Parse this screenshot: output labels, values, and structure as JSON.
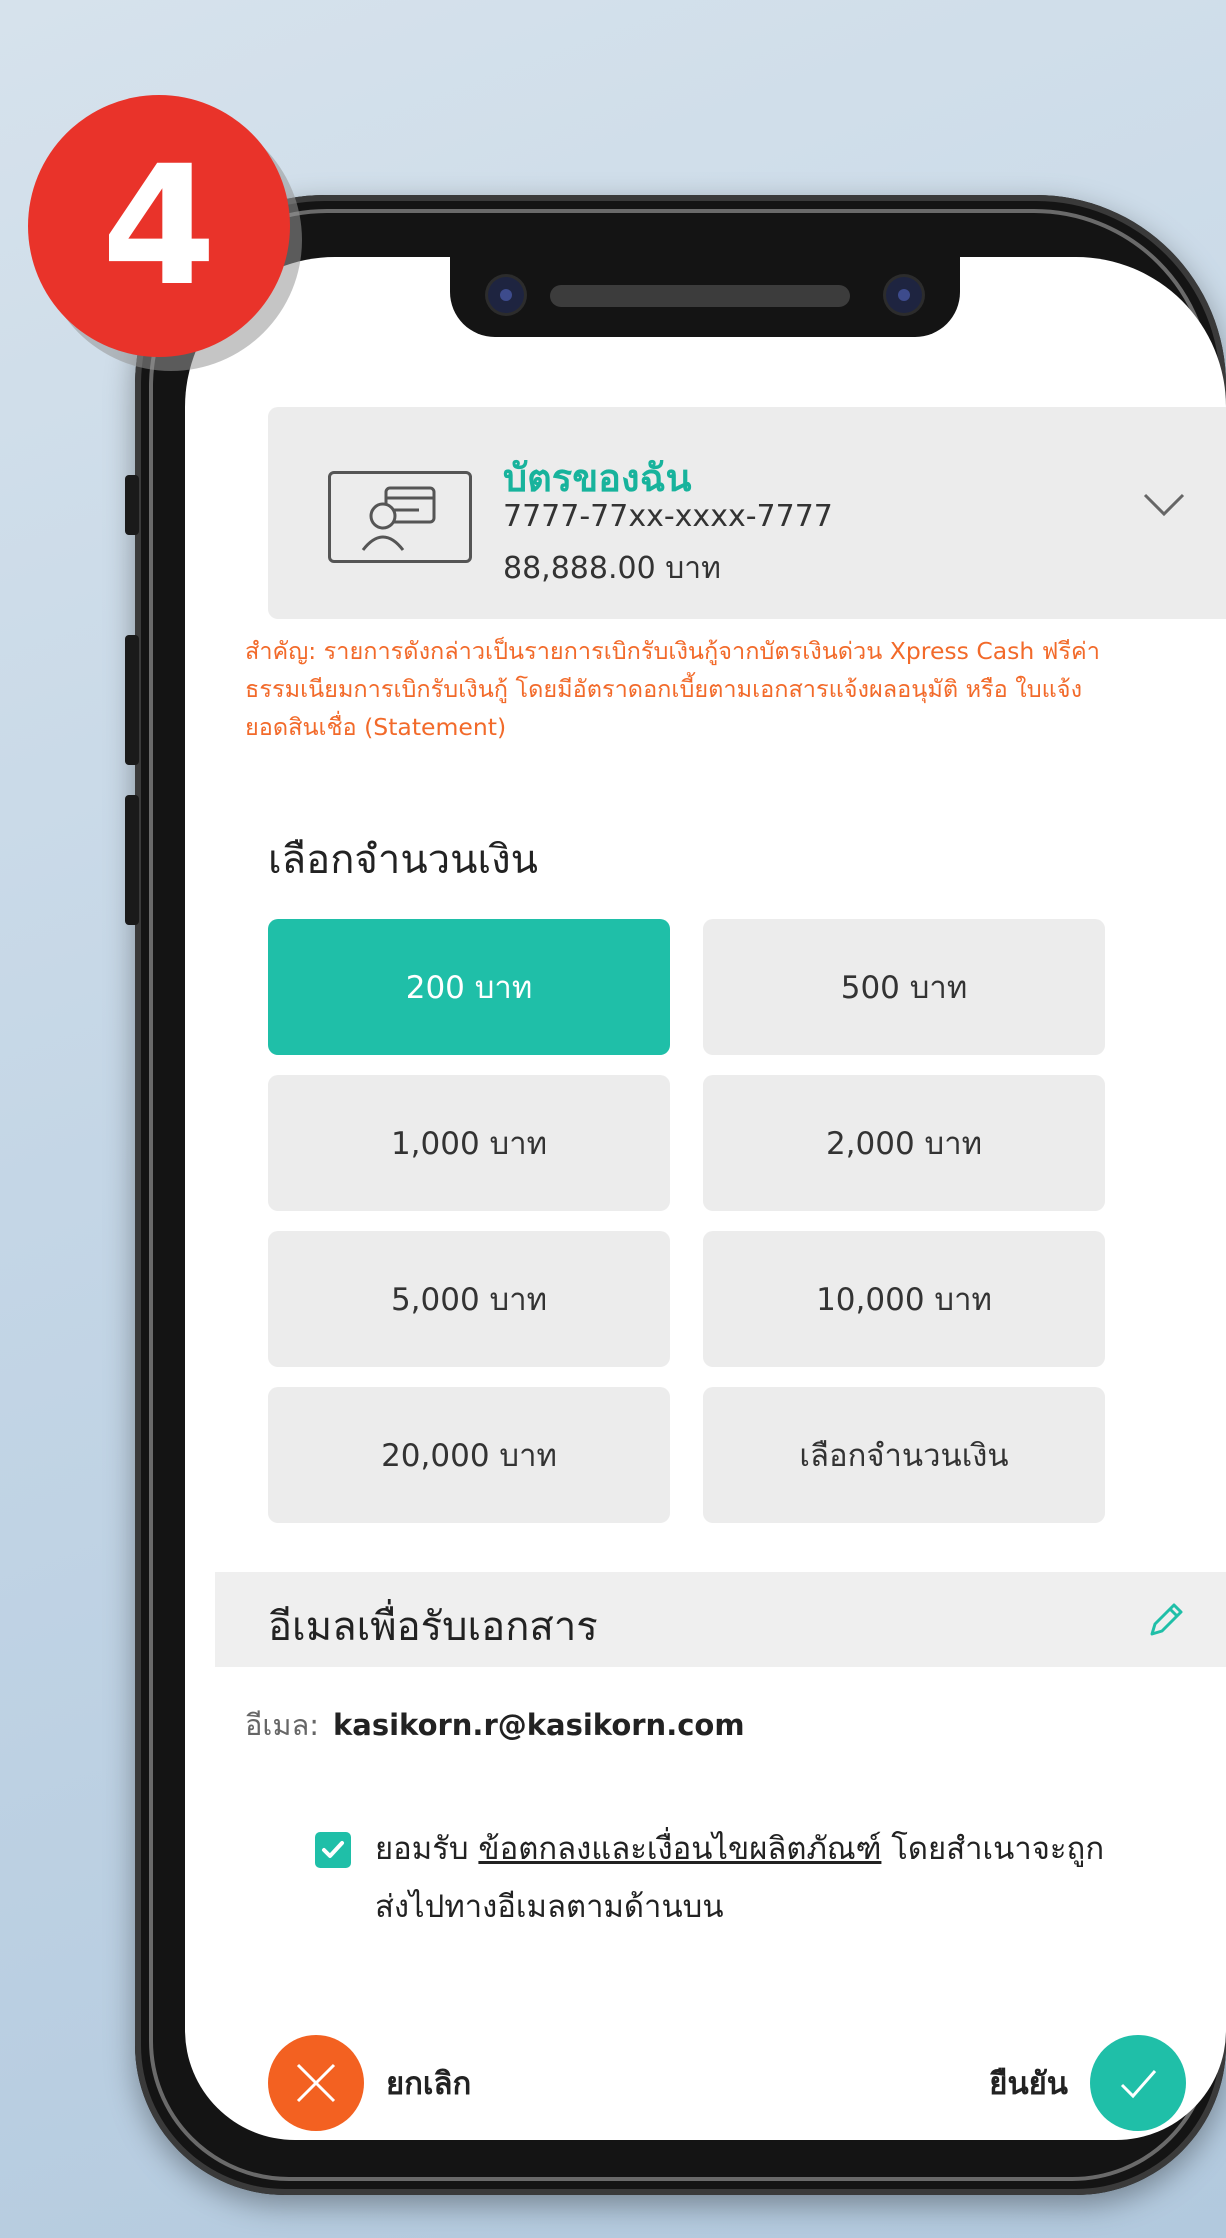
{
  "step_badge": "4",
  "card": {
    "title": "บัตรของฉัน",
    "number": "7777-77xx-xxxx-7777",
    "balance": "88,888.00 บาท",
    "icon": "credit-card-user-icon",
    "dropdown_icon": "chevron-down-icon"
  },
  "notice": "สำคัญ: รายการดังกล่าวเป็นรายการเบิกรับเงินกู้จากบัตรเงินด่วน Xpress Cash ฟรีค่าธรรมเนียมการเบิกรับเงินกู้ โดยมีอัตราดอกเบี้ยตามเอกสารแจ้งผลอนุมัติ หรือ ใบแจ้งยอดสินเชื่อ (Statement)",
  "amount_section": {
    "title": "เลือกจำนวนเงิน",
    "options": [
      {
        "label": "200 บาท",
        "selected": true
      },
      {
        "label": "500 บาท",
        "selected": false
      },
      {
        "label": "1,000 บาท",
        "selected": false
      },
      {
        "label": "2,000 บาท",
        "selected": false
      },
      {
        "label": "5,000 บาท",
        "selected": false
      },
      {
        "label": "10,000 บาท",
        "selected": false
      },
      {
        "label": "20,000 บาท",
        "selected": false
      },
      {
        "label": "เลือกจำนวนเงิน",
        "selected": false
      }
    ]
  },
  "email_section": {
    "title": "อีเมลเพื่อรับเอกสาร",
    "label": "อีเมล:",
    "value": "kasikorn.r@kasikorn.com",
    "edit_icon": "pencil-icon"
  },
  "consent": {
    "checked": true,
    "prefix": "ยอมรับ ",
    "link": "ข้อตกลงและเงื่อนไขผลิตภัณฑ์",
    "suffix": " โดยสำเนาจะถูกส่งไปทางอีเมลตามด้านบน"
  },
  "actions": {
    "cancel_label": "ยกเลิก",
    "confirm_label": "ยืนยัน"
  },
  "colors": {
    "accent": "#1fbfa8",
    "notice": "#f26a2a",
    "cancel": "#f36121",
    "badge": "#e9332a"
  }
}
